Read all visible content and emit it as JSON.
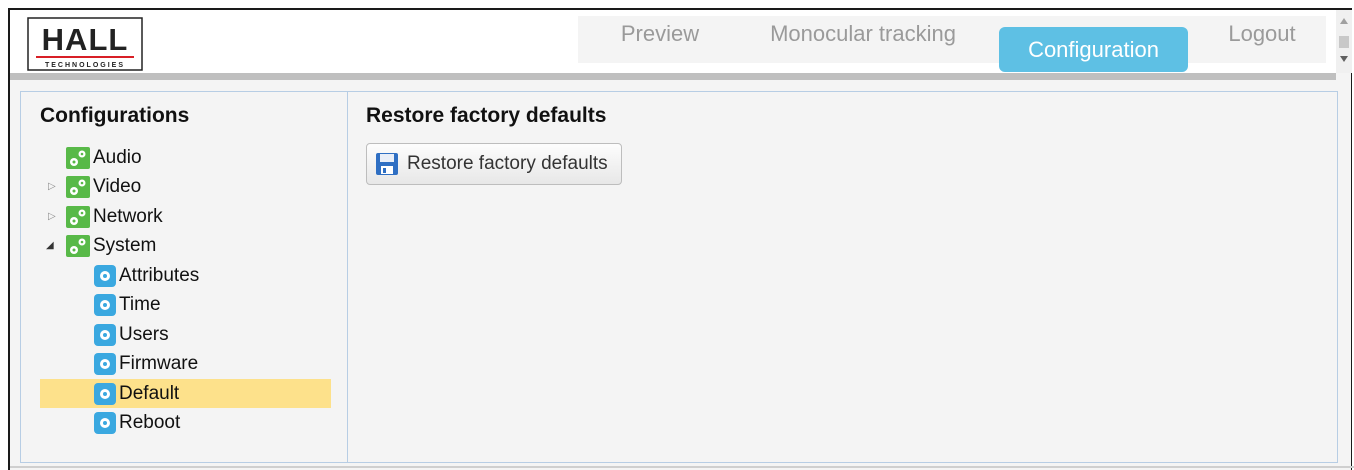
{
  "logo": {
    "text": "HALL",
    "subtext": "TECHNOLOGIES"
  },
  "nav": {
    "tabs": [
      {
        "label": "Preview"
      },
      {
        "label": "Monocular tracking"
      },
      {
        "label": "Configuration"
      },
      {
        "label": "Logout"
      }
    ],
    "active": "Configuration",
    "accent": "#5ec0e4"
  },
  "sidebar": {
    "title": "Configurations",
    "items": [
      {
        "label": "Audio",
        "icon": "gears-icon"
      },
      {
        "label": "Video",
        "icon": "gears-icon",
        "expander": "collapsed"
      },
      {
        "label": "Network",
        "icon": "gears-icon",
        "expander": "collapsed"
      },
      {
        "label": "System",
        "icon": "gears-icon",
        "expander": "expanded"
      }
    ],
    "system_children": [
      {
        "label": "Attributes",
        "icon": "gear-icon"
      },
      {
        "label": "Time",
        "icon": "gear-icon"
      },
      {
        "label": "Users",
        "icon": "gear-icon"
      },
      {
        "label": "Firmware",
        "icon": "gear-icon"
      },
      {
        "label": "Default",
        "icon": "gear-icon",
        "selected": true
      },
      {
        "label": "Reboot",
        "icon": "gear-icon"
      }
    ],
    "selected_color": "#fde18b"
  },
  "main": {
    "title": "Restore factory defaults",
    "button_label": "Restore factory defaults",
    "button_icon": "floppy-disk-icon"
  }
}
